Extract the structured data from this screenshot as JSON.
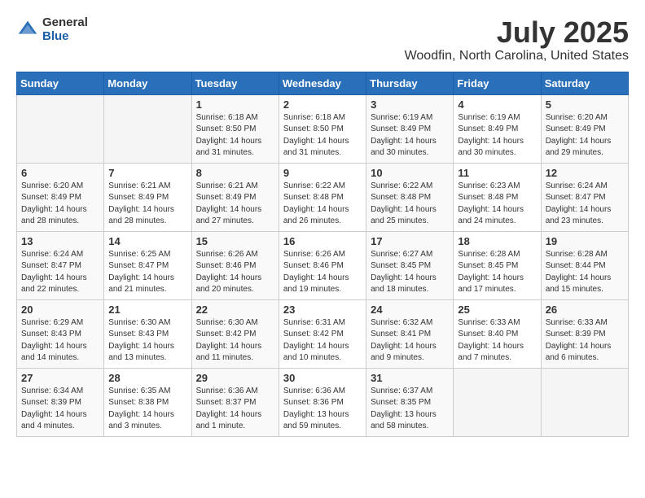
{
  "header": {
    "logo_general": "General",
    "logo_blue": "Blue",
    "month_title": "July 2025",
    "location": "Woodfin, North Carolina, United States"
  },
  "calendar": {
    "days_of_week": [
      "Sunday",
      "Monday",
      "Tuesday",
      "Wednesday",
      "Thursday",
      "Friday",
      "Saturday"
    ],
    "weeks": [
      [
        {
          "day": "",
          "info": ""
        },
        {
          "day": "",
          "info": ""
        },
        {
          "day": "1",
          "info": "Sunrise: 6:18 AM\nSunset: 8:50 PM\nDaylight: 14 hours\nand 31 minutes."
        },
        {
          "day": "2",
          "info": "Sunrise: 6:18 AM\nSunset: 8:50 PM\nDaylight: 14 hours\nand 31 minutes."
        },
        {
          "day": "3",
          "info": "Sunrise: 6:19 AM\nSunset: 8:49 PM\nDaylight: 14 hours\nand 30 minutes."
        },
        {
          "day": "4",
          "info": "Sunrise: 6:19 AM\nSunset: 8:49 PM\nDaylight: 14 hours\nand 30 minutes."
        },
        {
          "day": "5",
          "info": "Sunrise: 6:20 AM\nSunset: 8:49 PM\nDaylight: 14 hours\nand 29 minutes."
        }
      ],
      [
        {
          "day": "6",
          "info": "Sunrise: 6:20 AM\nSunset: 8:49 PM\nDaylight: 14 hours\nand 28 minutes."
        },
        {
          "day": "7",
          "info": "Sunrise: 6:21 AM\nSunset: 8:49 PM\nDaylight: 14 hours\nand 28 minutes."
        },
        {
          "day": "8",
          "info": "Sunrise: 6:21 AM\nSunset: 8:49 PM\nDaylight: 14 hours\nand 27 minutes."
        },
        {
          "day": "9",
          "info": "Sunrise: 6:22 AM\nSunset: 8:48 PM\nDaylight: 14 hours\nand 26 minutes."
        },
        {
          "day": "10",
          "info": "Sunrise: 6:22 AM\nSunset: 8:48 PM\nDaylight: 14 hours\nand 25 minutes."
        },
        {
          "day": "11",
          "info": "Sunrise: 6:23 AM\nSunset: 8:48 PM\nDaylight: 14 hours\nand 24 minutes."
        },
        {
          "day": "12",
          "info": "Sunrise: 6:24 AM\nSunset: 8:47 PM\nDaylight: 14 hours\nand 23 minutes."
        }
      ],
      [
        {
          "day": "13",
          "info": "Sunrise: 6:24 AM\nSunset: 8:47 PM\nDaylight: 14 hours\nand 22 minutes."
        },
        {
          "day": "14",
          "info": "Sunrise: 6:25 AM\nSunset: 8:47 PM\nDaylight: 14 hours\nand 21 minutes."
        },
        {
          "day": "15",
          "info": "Sunrise: 6:26 AM\nSunset: 8:46 PM\nDaylight: 14 hours\nand 20 minutes."
        },
        {
          "day": "16",
          "info": "Sunrise: 6:26 AM\nSunset: 8:46 PM\nDaylight: 14 hours\nand 19 minutes."
        },
        {
          "day": "17",
          "info": "Sunrise: 6:27 AM\nSunset: 8:45 PM\nDaylight: 14 hours\nand 18 minutes."
        },
        {
          "day": "18",
          "info": "Sunrise: 6:28 AM\nSunset: 8:45 PM\nDaylight: 14 hours\nand 17 minutes."
        },
        {
          "day": "19",
          "info": "Sunrise: 6:28 AM\nSunset: 8:44 PM\nDaylight: 14 hours\nand 15 minutes."
        }
      ],
      [
        {
          "day": "20",
          "info": "Sunrise: 6:29 AM\nSunset: 8:43 PM\nDaylight: 14 hours\nand 14 minutes."
        },
        {
          "day": "21",
          "info": "Sunrise: 6:30 AM\nSunset: 8:43 PM\nDaylight: 14 hours\nand 13 minutes."
        },
        {
          "day": "22",
          "info": "Sunrise: 6:30 AM\nSunset: 8:42 PM\nDaylight: 14 hours\nand 11 minutes."
        },
        {
          "day": "23",
          "info": "Sunrise: 6:31 AM\nSunset: 8:42 PM\nDaylight: 14 hours\nand 10 minutes."
        },
        {
          "day": "24",
          "info": "Sunrise: 6:32 AM\nSunset: 8:41 PM\nDaylight: 14 hours\nand 9 minutes."
        },
        {
          "day": "25",
          "info": "Sunrise: 6:33 AM\nSunset: 8:40 PM\nDaylight: 14 hours\nand 7 minutes."
        },
        {
          "day": "26",
          "info": "Sunrise: 6:33 AM\nSunset: 8:39 PM\nDaylight: 14 hours\nand 6 minutes."
        }
      ],
      [
        {
          "day": "27",
          "info": "Sunrise: 6:34 AM\nSunset: 8:39 PM\nDaylight: 14 hours\nand 4 minutes."
        },
        {
          "day": "28",
          "info": "Sunrise: 6:35 AM\nSunset: 8:38 PM\nDaylight: 14 hours\nand 3 minutes."
        },
        {
          "day": "29",
          "info": "Sunrise: 6:36 AM\nSunset: 8:37 PM\nDaylight: 14 hours\nand 1 minute."
        },
        {
          "day": "30",
          "info": "Sunrise: 6:36 AM\nSunset: 8:36 PM\nDaylight: 13 hours\nand 59 minutes."
        },
        {
          "day": "31",
          "info": "Sunrise: 6:37 AM\nSunset: 8:35 PM\nDaylight: 13 hours\nand 58 minutes."
        },
        {
          "day": "",
          "info": ""
        },
        {
          "day": "",
          "info": ""
        }
      ]
    ]
  }
}
